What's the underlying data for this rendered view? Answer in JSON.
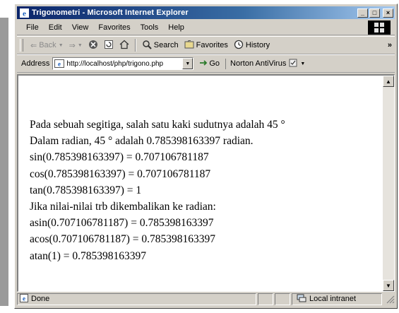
{
  "window": {
    "title": "Trigonometri - Microsoft Internet Explorer",
    "buttons": [
      "_",
      "□",
      "×"
    ]
  },
  "menu": {
    "items": [
      "File",
      "Edit",
      "View",
      "Favorites",
      "Tools",
      "Help"
    ]
  },
  "toolbar": {
    "back": "Back",
    "search": "Search",
    "favorites": "Favorites",
    "history": "History",
    "more": "»"
  },
  "address": {
    "label": "Address",
    "value": "http://localhost/php/trigono.php",
    "go": "Go",
    "norton": "Norton AntiVirus"
  },
  "page": {
    "lines": [
      "Pada sebuah segitiga, salah satu kaki sudutnya adalah 45 °",
      "Dalam radian, 45 ° adalah 0.785398163397 radian.",
      "sin(0.785398163397) = 0.707106781187",
      "cos(0.785398163397) = 0.707106781187",
      "tan(0.785398163397) = 1",
      "Jika nilai-nilai trb dikembalikan ke radian:",
      "asin(0.707106781187) = 0.785398163397",
      "acos(0.707106781187) = 0.785398163397",
      "atan(1) = 0.785398163397"
    ]
  },
  "status": {
    "text": "Done",
    "zone": "Local intranet"
  },
  "icons": {
    "ie": "ie-logo-icon",
    "windows": "windows-logo-icon",
    "page": "page-icon",
    "zone": "local-intranet-icon"
  }
}
